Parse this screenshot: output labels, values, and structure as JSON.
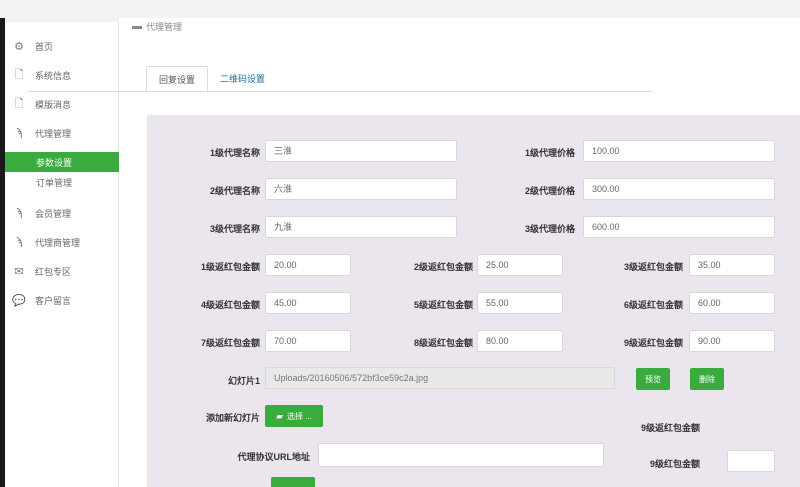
{
  "header": {
    "title": "代理管理"
  },
  "sidebar": {
    "items": [
      {
        "label": "首页",
        "icon": "cogs-icon"
      },
      {
        "label": "系统信息",
        "icon": "document-icon"
      },
      {
        "label": "模版消息",
        "icon": "document-icon"
      },
      {
        "label": "代理管理",
        "icon": "rss-icon"
      },
      {
        "label": "会员管理",
        "icon": "rss-icon"
      },
      {
        "label": "代理商管理",
        "icon": "rss-icon"
      },
      {
        "label": "红包专区",
        "icon": "mail-icon"
      },
      {
        "label": "客户留言",
        "icon": "chat-icon"
      }
    ],
    "subitems": [
      {
        "label": "参数设置",
        "active": true
      },
      {
        "label": "订单管理",
        "active": false
      }
    ]
  },
  "tabs": [
    {
      "label": "回复设置",
      "active": true
    },
    {
      "label": "二维码设置",
      "active": false
    }
  ],
  "agents": [
    {
      "name_label": "1级代理名称",
      "name": "三淮",
      "price_label": "1级代理价格",
      "price": "100.00"
    },
    {
      "name_label": "2级代理名称",
      "name": "六淮",
      "price_label": "2级代理价格",
      "price": "300.00"
    },
    {
      "name_label": "3级代理名称",
      "name": "九淮",
      "price_label": "3级代理价格",
      "price": "600.00"
    }
  ],
  "redpacks": [
    {
      "label": "1级返红包金额",
      "value": "20.00"
    },
    {
      "label": "2级返红包金额",
      "value": "25.00"
    },
    {
      "label": "3级返红包金额",
      "value": "35.00"
    },
    {
      "label": "4级返红包金额",
      "value": "45.00"
    },
    {
      "label": "5级返红包金额",
      "value": "55.00"
    },
    {
      "label": "6级返红包金额",
      "value": "60.00"
    },
    {
      "label": "7级返红包金额",
      "value": "70.00"
    },
    {
      "label": "8级返红包金额",
      "value": "80.00"
    },
    {
      "label": "9级返红包金额",
      "value": "90.00"
    }
  ],
  "slide": {
    "label": "幻灯片1",
    "path": "Uploads/20160506/572bf3ce59c2a.jpg",
    "preview_label": "预览",
    "delete_label": "删除"
  },
  "add_slide": {
    "label": "添加新幻灯片",
    "button_label": "选择 ..."
  },
  "agreement": {
    "label": "代理协议URL地址",
    "value": ""
  },
  "extra": {
    "label1": "9级返红包金额",
    "label2": "9级红包金额",
    "value2": ""
  },
  "colors": {
    "accent": "#3aab3f",
    "panel": "#ebe5ee",
    "link": "#1e6fa8"
  }
}
